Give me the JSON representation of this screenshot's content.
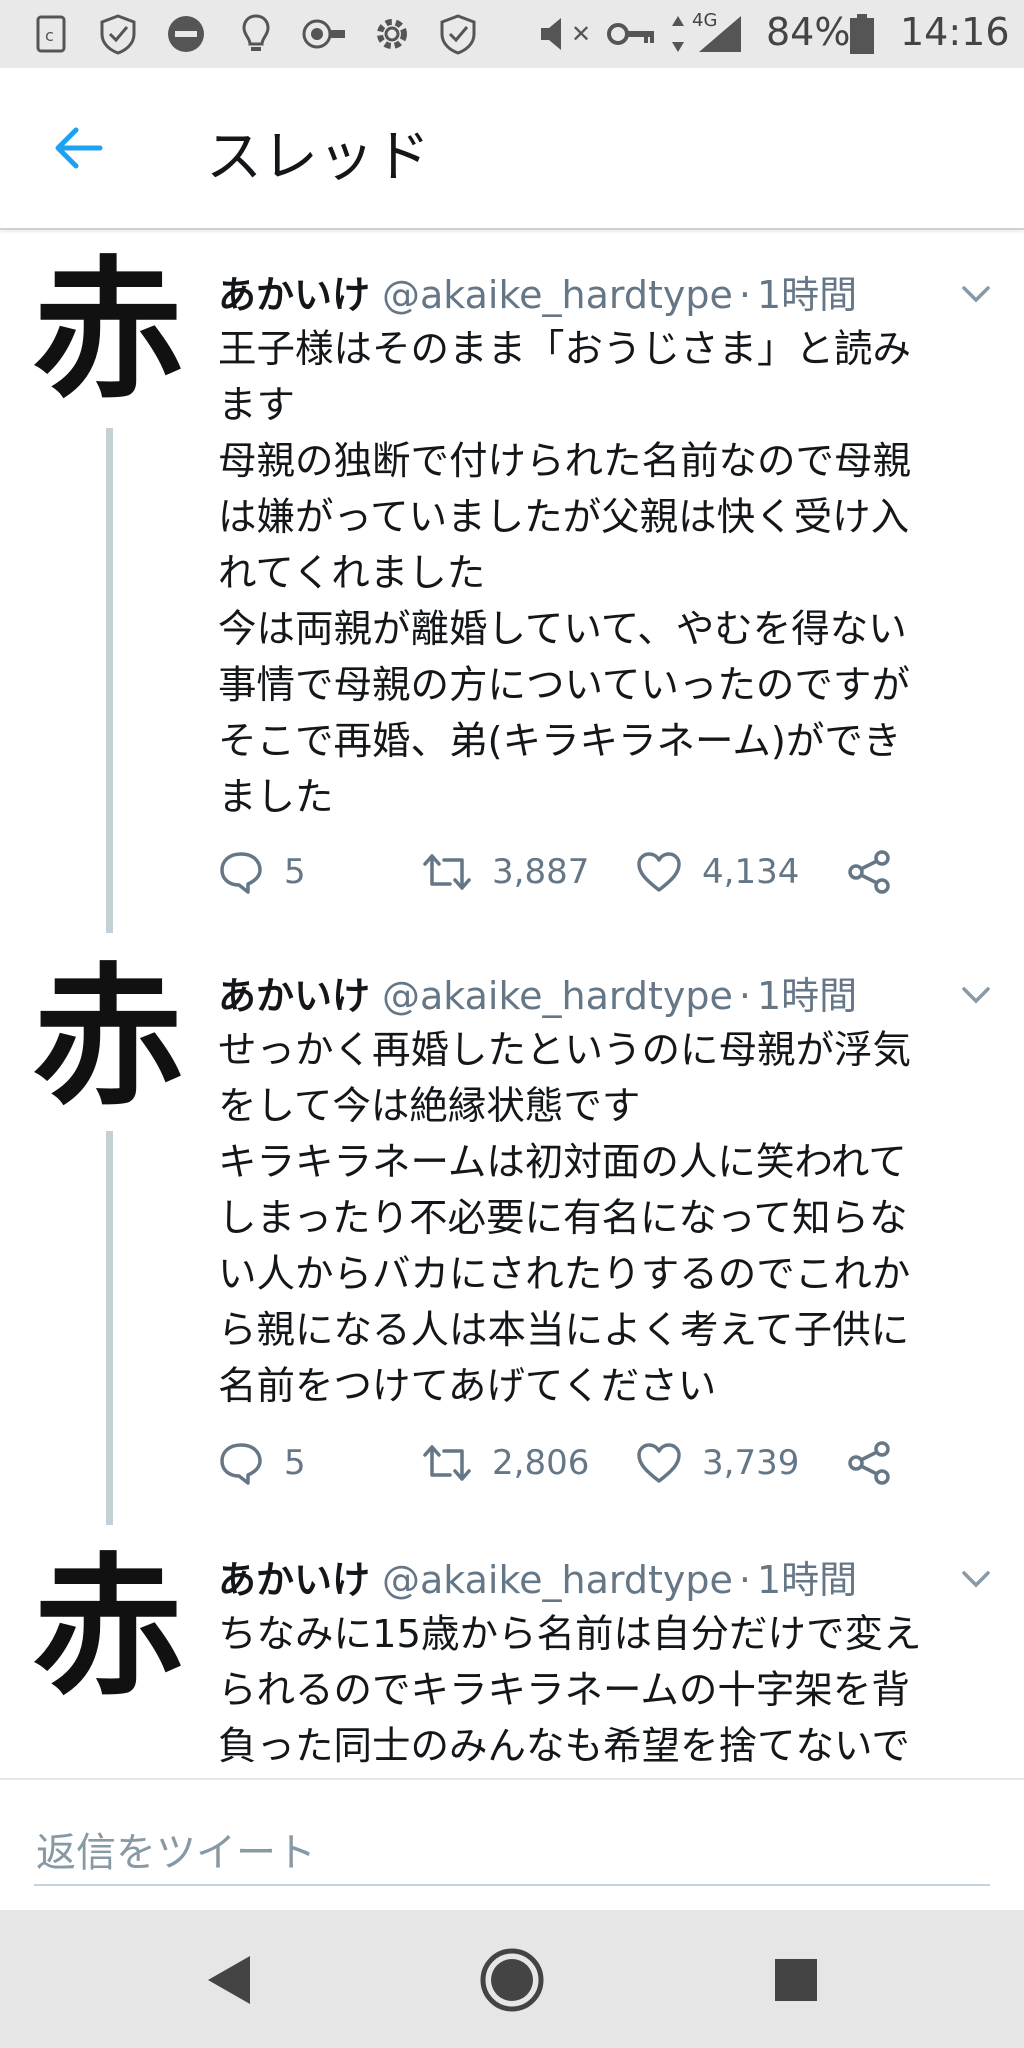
{
  "status_bar": {
    "mute_label": "✕",
    "network_label": "4G",
    "battery_percent": "84%",
    "time": "14:16",
    "icons": [
      "sim-icon",
      "shield-sync-icon",
      "do-not-disturb-icon",
      "lightbulb-icon",
      "toggle-icon",
      "settings-icon",
      "shield-icon",
      "mute-icon",
      "key-icon",
      "data-arrows-icon",
      "signal-icon",
      "battery-icon"
    ]
  },
  "header": {
    "title": "スレッド",
    "back_icon": "arrow-left-icon",
    "accent": "#1da1f2"
  },
  "tweets": [
    {
      "avatar_char": "赤",
      "name": "あかいけ",
      "handle": "@akaike_hardtype",
      "separator": "·",
      "time": "1時間",
      "text": "王子様はそのまま「おうじさま」と読み\nます\n母親の独断で付けられた名前なので母親\nは嫌がっていましたが父親は快く受け入\nれてくれました\n今は両親が離婚していて、やむを得ない\n事情で母親の方についていったのですが\nそこで再婚、弟(キラキラネーム)ができ\nました",
      "replies": "5",
      "retweets": "3,887",
      "likes": "4,134"
    },
    {
      "avatar_char": "赤",
      "name": "あかいけ",
      "handle": "@akaike_hardtype",
      "separator": "·",
      "time": "1時間",
      "text": "せっかく再婚したというのに母親が浮気\nをして今は絶縁状態です\nキラキラネームは初対面の人に笑われて\nしまったり不必要に有名になって知らな\nい人からバカにされたりするのでこれか\nら親になる人は本当によく考えて子供に\n名前をつけてあげてください",
      "replies": "5",
      "retweets": "2,806",
      "likes": "3,739"
    },
    {
      "avatar_char": "赤",
      "name": "あかいけ",
      "handle": "@akaike_hardtype",
      "separator": "·",
      "time": "1時間",
      "text": "ちなみに15歳から名前は自分だけで変え\nられるのでキラキラネームの十字架を背\n負った同士のみんなも希望を捨てないで"
    }
  ],
  "reply_bar": {
    "placeholder": "返信をツイート"
  },
  "nav_bar": {
    "icons": [
      "back-triangle-icon",
      "home-circle-icon",
      "recents-square-icon"
    ]
  }
}
